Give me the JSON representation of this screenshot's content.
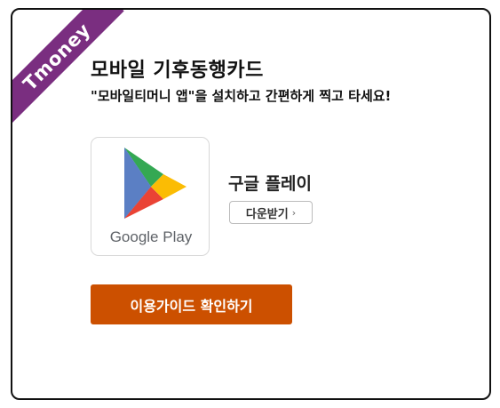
{
  "badge": {
    "label": "Tmoney",
    "color": "#7a2e80"
  },
  "header": {
    "title": "모바일 기후동행카드",
    "subtitle": "\"모바일티머니 앱\"을 설치하고 간편하게 찍고 타세요!"
  },
  "store": {
    "logo_icon": "google-play-icon",
    "logo_text": "Google Play",
    "name": "구글 플레이",
    "download_label": "다운받기",
    "download_chevron": "›"
  },
  "guide_button": {
    "label": "이용가이드 확인하기",
    "color": "#cc5000"
  }
}
